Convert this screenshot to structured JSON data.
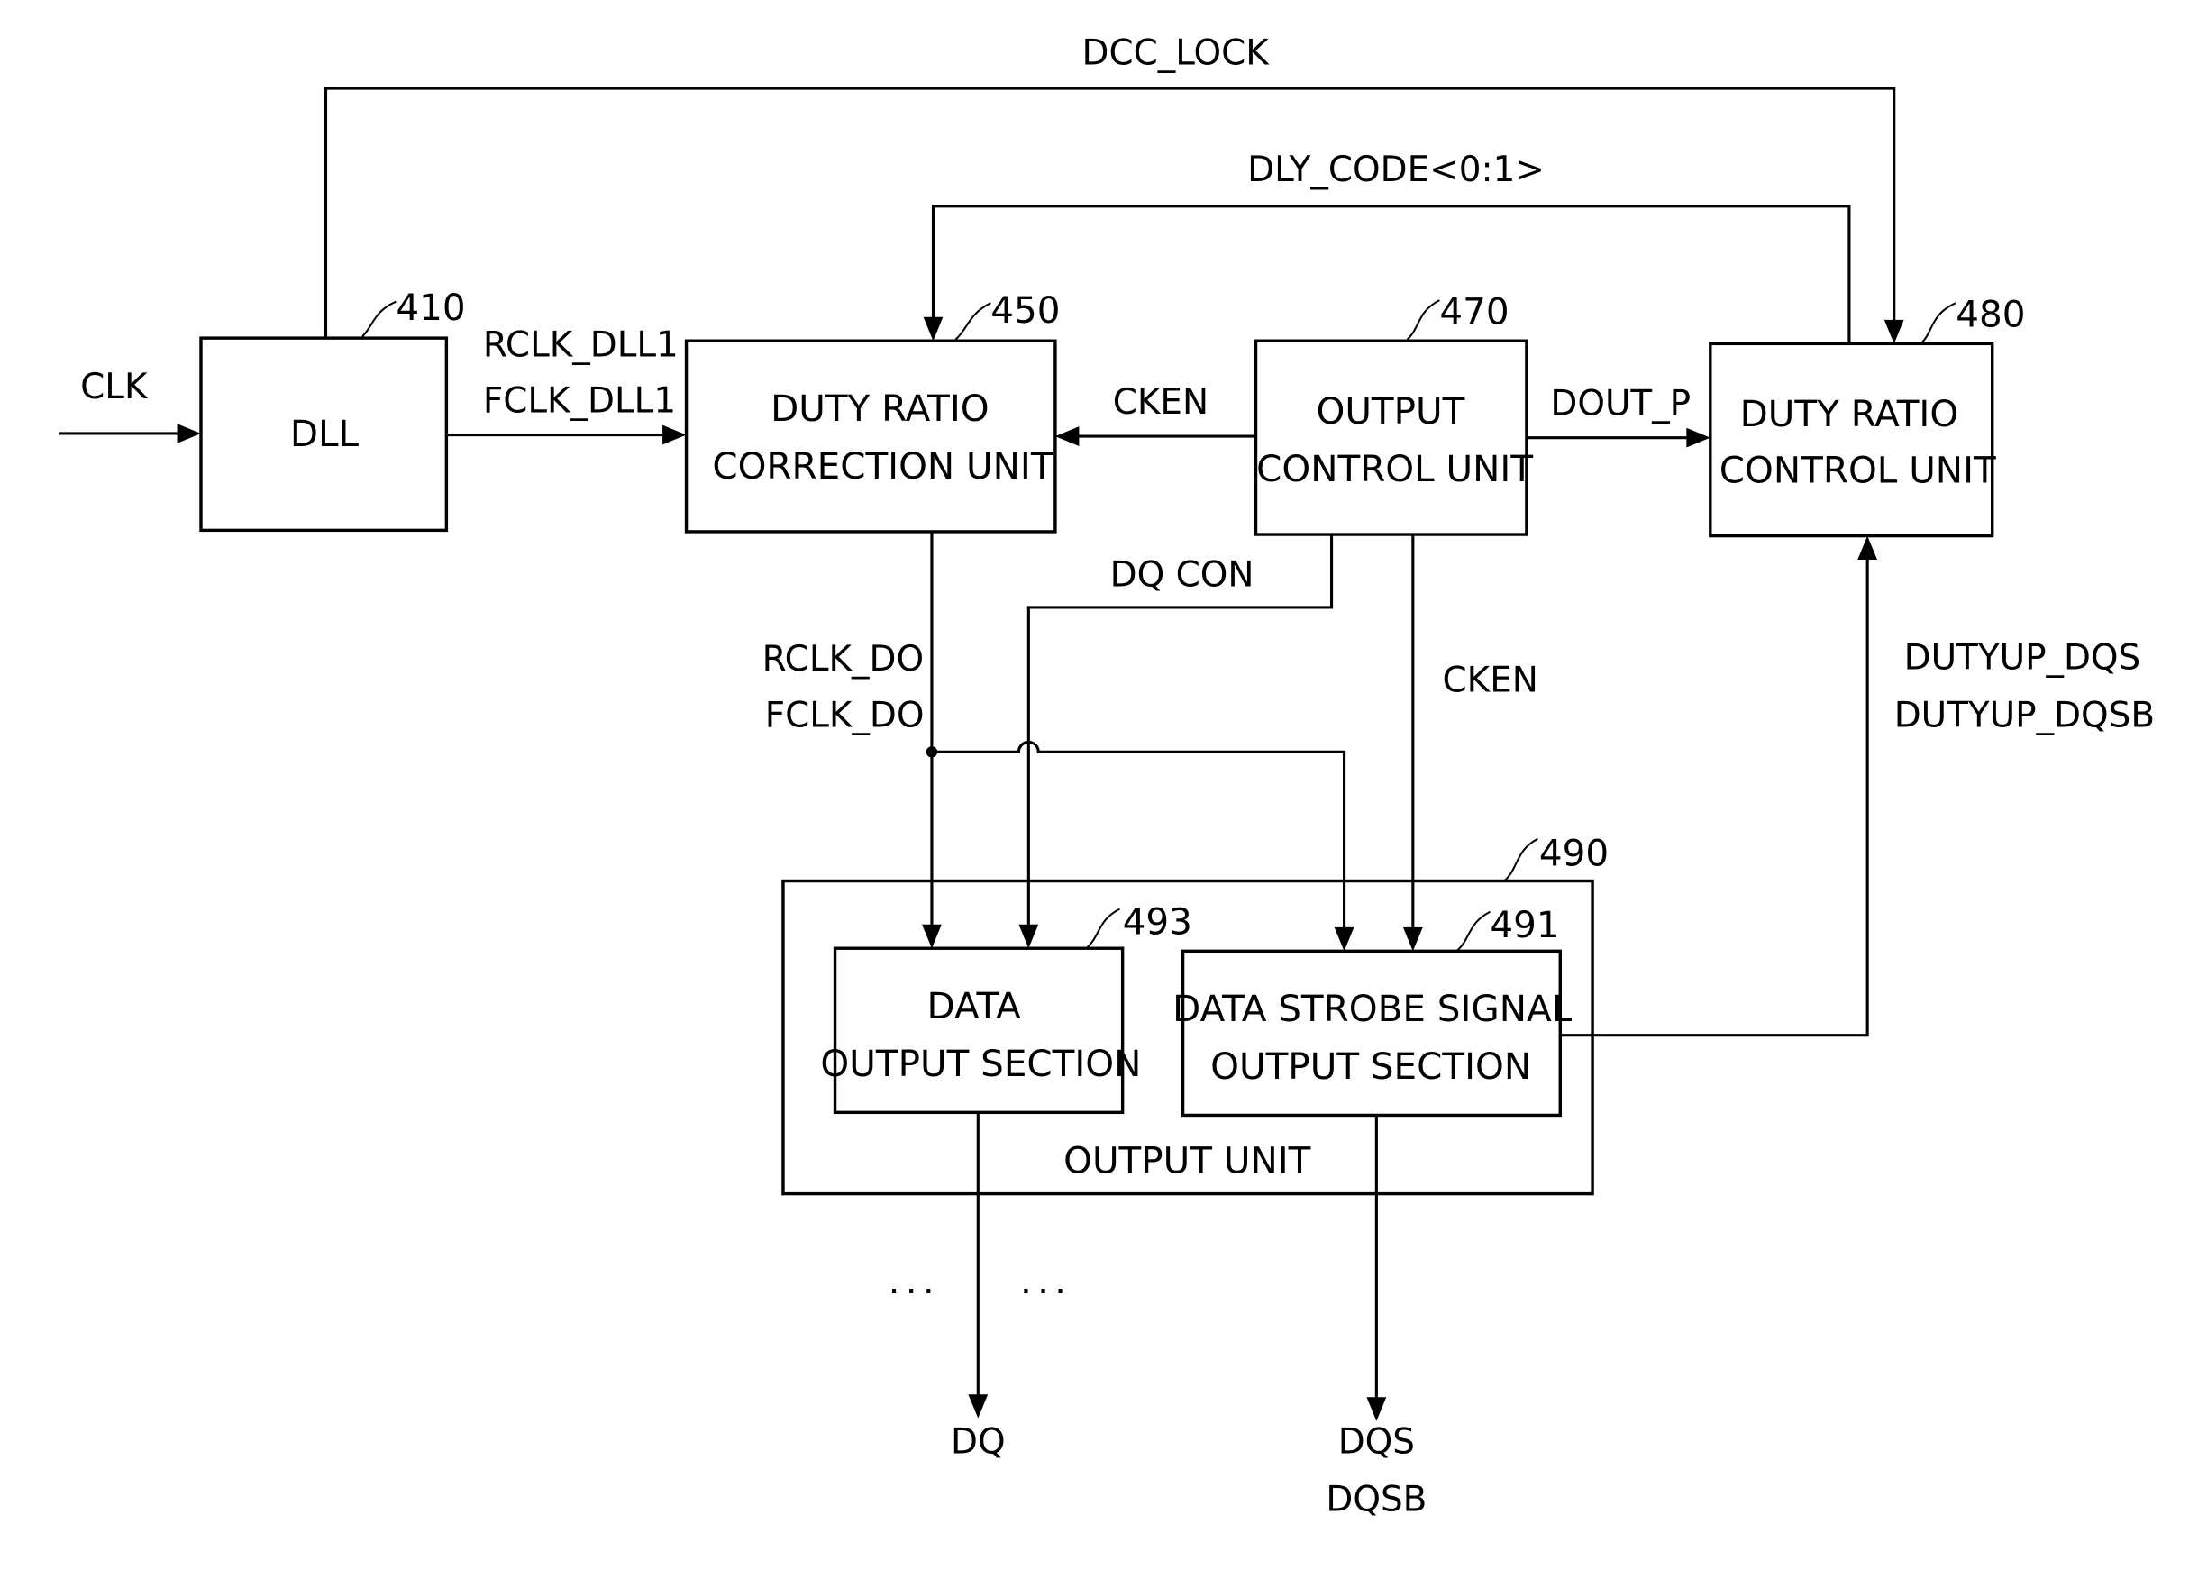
{
  "diagram": {
    "type": "block-diagram",
    "inputs": {
      "clk": "CLK"
    },
    "blocks": {
      "dll": {
        "ref": "410",
        "lines": [
          "DLL"
        ]
      },
      "duty_ratio_correction": {
        "ref": "450",
        "lines": [
          "DUTY RATIO",
          "CORRECTION UNIT"
        ]
      },
      "output_control": {
        "ref": "470",
        "lines": [
          "OUTPUT",
          "CONTROL UNIT"
        ]
      },
      "duty_ratio_control": {
        "ref": "480",
        "lines": [
          "DUTY RATIO",
          "CONTROL UNIT"
        ]
      },
      "output_unit": {
        "ref": "490",
        "label": "OUTPUT UNIT"
      },
      "data_output_section": {
        "ref": "493",
        "lines": [
          "DATA",
          "OUTPUT SECTION"
        ]
      },
      "dqs_output_section": {
        "ref": "491",
        "lines": [
          "DATA STROBE SIGNAL",
          "OUTPUT SECTION"
        ]
      }
    },
    "signals": {
      "dcc_lock": "DCC_LOCK",
      "dly_code": "DLY_CODE<0:1>",
      "rclk_dll1": "RCLK_DLL1",
      "fclk_dll1": "FCLK_DLL1",
      "cken_left": "CKEN",
      "dout_p": "DOUT_P",
      "dq_con": "DQ CON",
      "rclk_do": "RCLK_DO",
      "fclk_do": "FCLK_DO",
      "cken_down": "CKEN",
      "dutyup_dqs": "DUTYUP_DQS",
      "dutyup_dqsb": "DUTYUP_DQSB"
    },
    "outputs": {
      "dq": "DQ",
      "dqs": "DQS",
      "dqsb": "DQSB",
      "ellipsis_left": "...",
      "ellipsis_right": "..."
    },
    "connections": [
      {
        "from": "CLK",
        "to": "DLL"
      },
      {
        "from": "DLL",
        "to": "DUTY RATIO CORRECTION UNIT",
        "signal": "RCLK_DLL1 / FCLK_DLL1"
      },
      {
        "from": "DLL",
        "to": "DUTY RATIO CONTROL UNIT",
        "signal": "DCC_LOCK"
      },
      {
        "from": "DUTY RATIO CONTROL UNIT",
        "to": "DUTY RATIO CORRECTION UNIT",
        "signal": "DLY_CODE<0:1>"
      },
      {
        "from": "OUTPUT CONTROL UNIT",
        "to": "DUTY RATIO CORRECTION UNIT",
        "signal": "CKEN"
      },
      {
        "from": "OUTPUT CONTROL UNIT",
        "to": "DUTY RATIO CONTROL UNIT",
        "signal": "DOUT_P"
      },
      {
        "from": "OUTPUT CONTROL UNIT",
        "to": "DATA OUTPUT SECTION",
        "signal": "DQ CON"
      },
      {
        "from": "OUTPUT CONTROL UNIT",
        "to": "DATA STROBE SIGNAL OUTPUT SECTION",
        "signal": "CKEN"
      },
      {
        "from": "DUTY RATIO CORRECTION UNIT",
        "to": "DATA OUTPUT SECTION",
        "signal": "RCLK_DO / FCLK_DO"
      },
      {
        "from": "DUTY RATIO CORRECTION UNIT",
        "to": "DATA STROBE SIGNAL OUTPUT SECTION",
        "signal": "RCLK_DO / FCLK_DO"
      },
      {
        "from": "DATA STROBE SIGNAL OUTPUT SECTION",
        "to": "DUTY RATIO CONTROL UNIT",
        "signal": "DUTYUP_DQS / DUTYUP_DQSB"
      },
      {
        "from": "DATA OUTPUT SECTION",
        "to": "DQ"
      },
      {
        "from": "DATA STROBE SIGNAL OUTPUT SECTION",
        "to": "DQS / DQSB"
      }
    ]
  }
}
